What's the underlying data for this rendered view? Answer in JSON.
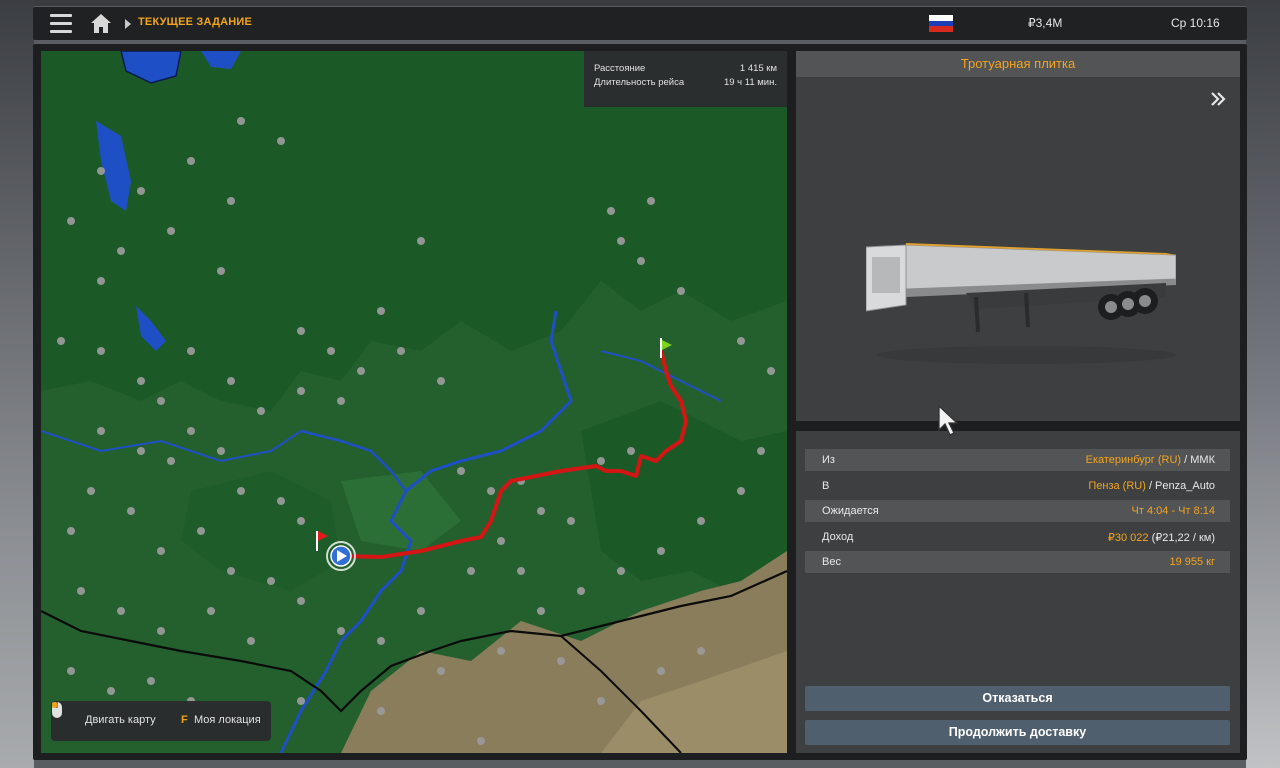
{
  "topbar": {
    "breadcrumb": "ТЕКУЩЕЕ ЗАДАНИЕ",
    "money": "₽3,4М",
    "clock": "Ср 10:16",
    "icons": [
      "menu-icon",
      "home-icon",
      "flag-russia-icon"
    ]
  },
  "map": {
    "route_info": {
      "distance_label": "Расстояние",
      "distance_value": "1 415 км",
      "duration_label": "Длительность рейса",
      "duration_value": "19 ч 11 мин."
    },
    "help": {
      "move_label": "Двигать карту",
      "location_key": "F",
      "location_label": "Моя локация"
    }
  },
  "cargo": {
    "title": "Тротуарная плитка"
  },
  "details": {
    "from_label": "Из",
    "from_city": "Екатеринбург (RU)",
    "from_company": " / ММК",
    "to_label": "В",
    "to_city": "Пенза (RU)",
    "to_company": " / Penza_Auto",
    "eta_label": "Ожидается",
    "eta_value": "Чт 4:04 - Чт 8:14",
    "income_label": "Доход",
    "income_value": "₽30 022",
    "income_rate": " (₽21,22 / км)",
    "weight_label": "Вес",
    "weight_value": "19 955 кг"
  },
  "buttons": {
    "decline": "Отказаться",
    "continue": "Продолжить доставку"
  },
  "colors": {
    "accent": "#f3a51c",
    "route": "#d51414",
    "map_green": "#23602e",
    "map_dark_green": "#1b5a26",
    "steppe": "#8a7d5c",
    "water": "#1f4fc4"
  }
}
